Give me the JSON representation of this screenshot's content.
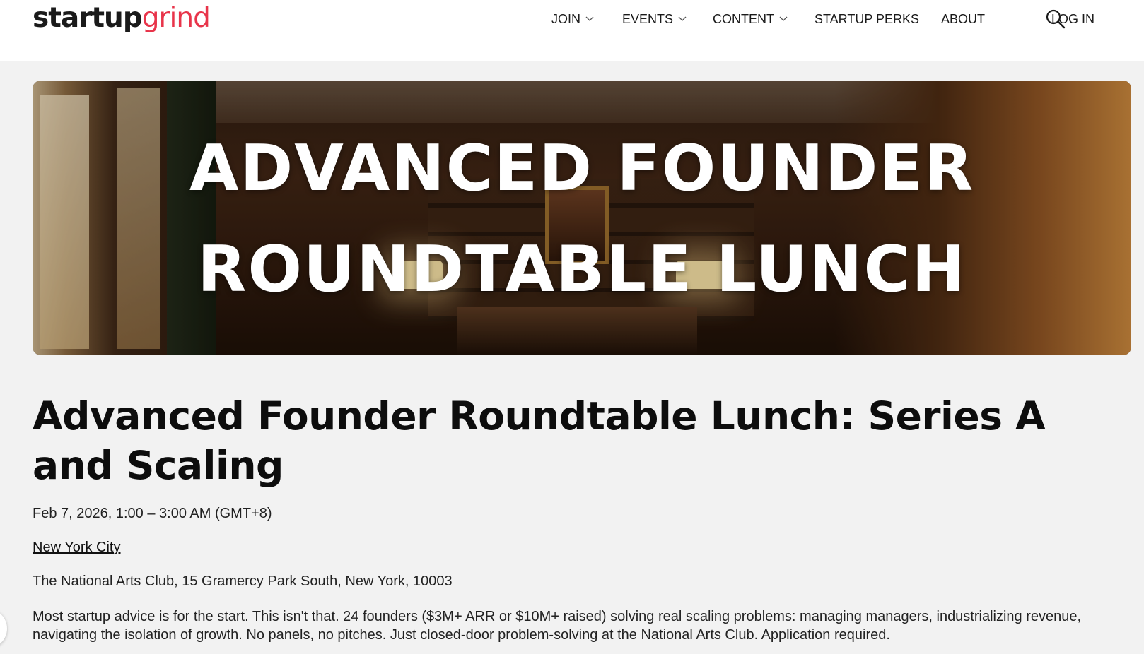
{
  "logo": {
    "part1": "startup",
    "part2": "grind"
  },
  "nav": {
    "items": [
      {
        "label": "JOIN",
        "dropdown": true
      },
      {
        "label": "EVENTS",
        "dropdown": true
      },
      {
        "label": "CONTENT",
        "dropdown": true
      },
      {
        "label": "STARTUP PERKS",
        "dropdown": false
      },
      {
        "label": "ABOUT",
        "dropdown": false
      }
    ],
    "search_icon": "search-icon",
    "login": "LOG IN"
  },
  "hero": {
    "line1": "ADVANCED FOUNDER",
    "line2": "ROUNDTABLE LUNCH"
  },
  "event": {
    "title": "Advanced Founder Roundtable Lunch: Series A and Scaling",
    "datetime": "Feb 7, 2026, 1:00 – 3:00 AM (GMT+8)",
    "city": "New York City",
    "venue": "The National Arts Club, 15 Gramercy Park South, New York, 10003",
    "description": "Most startup advice is for the start. This isn't that. 24 founders ($3M+ ARR or $10M+ raised) solving real scaling problems: managing managers, industrializing revenue, navigating the isolation of growth. No panels, no pitches. Just closed-door problem-solving at the National Arts Club. Application required."
  },
  "colors": {
    "brand_red": "#e8344a",
    "background": "#f2f2f2",
    "header_bg": "#ffffff"
  }
}
